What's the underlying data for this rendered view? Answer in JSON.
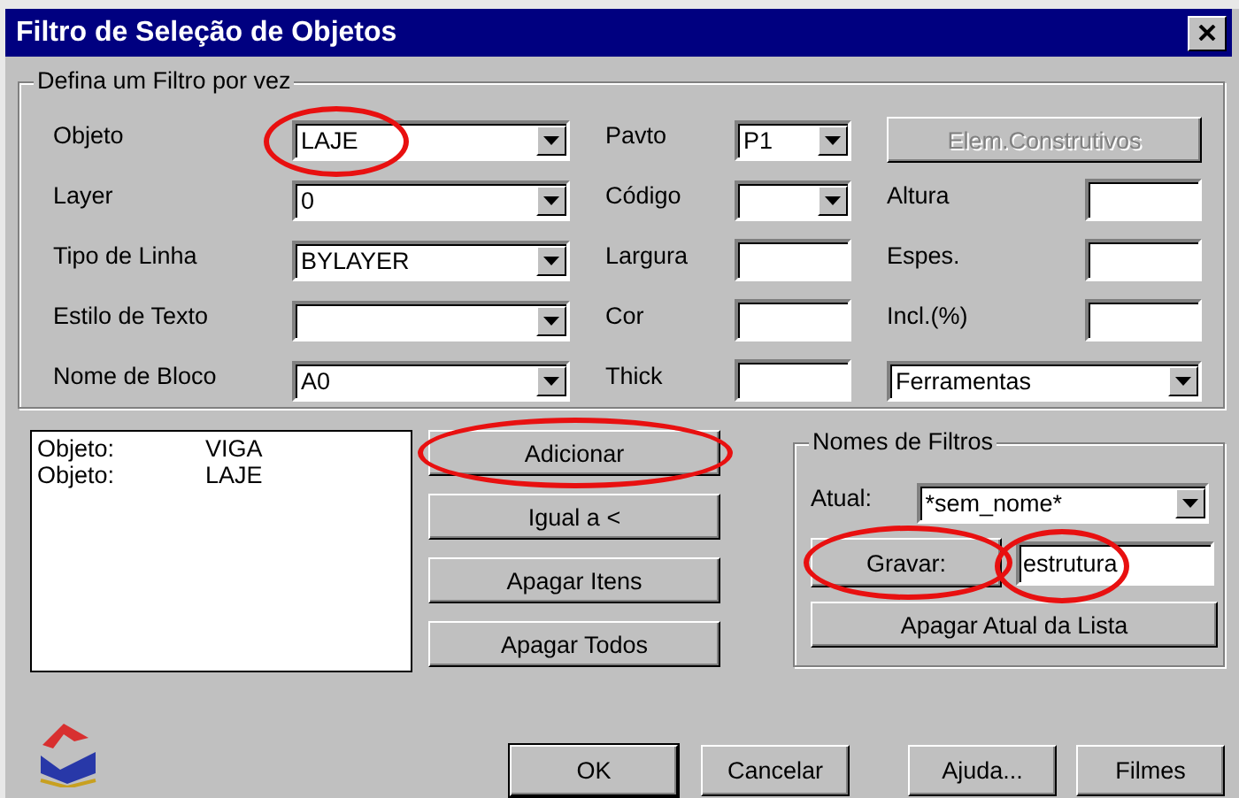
{
  "window": {
    "title": "Filtro de Seleção de Objetos"
  },
  "filter_group": {
    "title": "Defina um Filtro por vez",
    "rows": [
      {
        "cells": [
          {
            "kind": "combo",
            "label": "Objeto",
            "value": "LAJE",
            "highlighted": true
          },
          {
            "kind": "combo",
            "label": "Pavto",
            "value": "P1",
            "highlighted": false
          },
          {
            "kind": "button",
            "label": "Elem.Construtivos",
            "disabled": true
          }
        ]
      },
      {
        "cells": [
          {
            "kind": "combo",
            "label": "Layer",
            "value": "0",
            "highlighted": false
          },
          {
            "kind": "combo",
            "label": "Código",
            "highlighted": false
          },
          {
            "kind": "input",
            "label": "Altura"
          }
        ]
      },
      {
        "cells": [
          {
            "kind": "combo",
            "label": "Tipo de Linha",
            "value": "BYLAYER",
            "highlighted": false
          },
          {
            "kind": "input",
            "label": "Largura"
          },
          {
            "kind": "input",
            "label": "Espes."
          }
        ]
      },
      {
        "cells": [
          {
            "kind": "combo",
            "label": "Estilo de Texto",
            "highlighted": false
          },
          {
            "kind": "input",
            "label": "Cor"
          },
          {
            "kind": "input",
            "label": "Incl.(%)"
          }
        ]
      },
      {
        "cells": [
          {
            "kind": "combo",
            "label": "Nome de Bloco",
            "value": "A0",
            "highlighted": false
          },
          {
            "kind": "input",
            "label": "Thick"
          },
          {
            "kind": "combo",
            "value": "Ferramentas",
            "highlighted": false
          }
        ]
      }
    ]
  },
  "filter_list": [
    {
      "name": "Objeto:",
      "value": "VIGA"
    },
    {
      "name": "Objeto:",
      "value": "LAJE"
    }
  ],
  "list_buttons": [
    {
      "label": "Adicionar",
      "highlighted": true
    },
    {
      "label": "Igual a <",
      "highlighted": false
    },
    {
      "label": "Apagar Itens",
      "highlighted": false
    },
    {
      "label": "Apagar Todos",
      "highlighted": false
    }
  ],
  "names_group": {
    "title": "Nomes de Filtros",
    "current_label": "Atual:",
    "current_value": "*sem_nome*",
    "save_button": {
      "label": "Gravar:",
      "highlighted": true
    },
    "name_field": {
      "value": "estrutura",
      "highlighted": true
    },
    "delete_button": "Apagar Atual da Lista"
  },
  "footer_buttons": [
    {
      "label": "OK",
      "default": true
    },
    {
      "label": "Cancelar",
      "default": false
    },
    {
      "label": "Ajuda...",
      "default": false
    },
    {
      "label": "Filmes",
      "default": false
    }
  ]
}
